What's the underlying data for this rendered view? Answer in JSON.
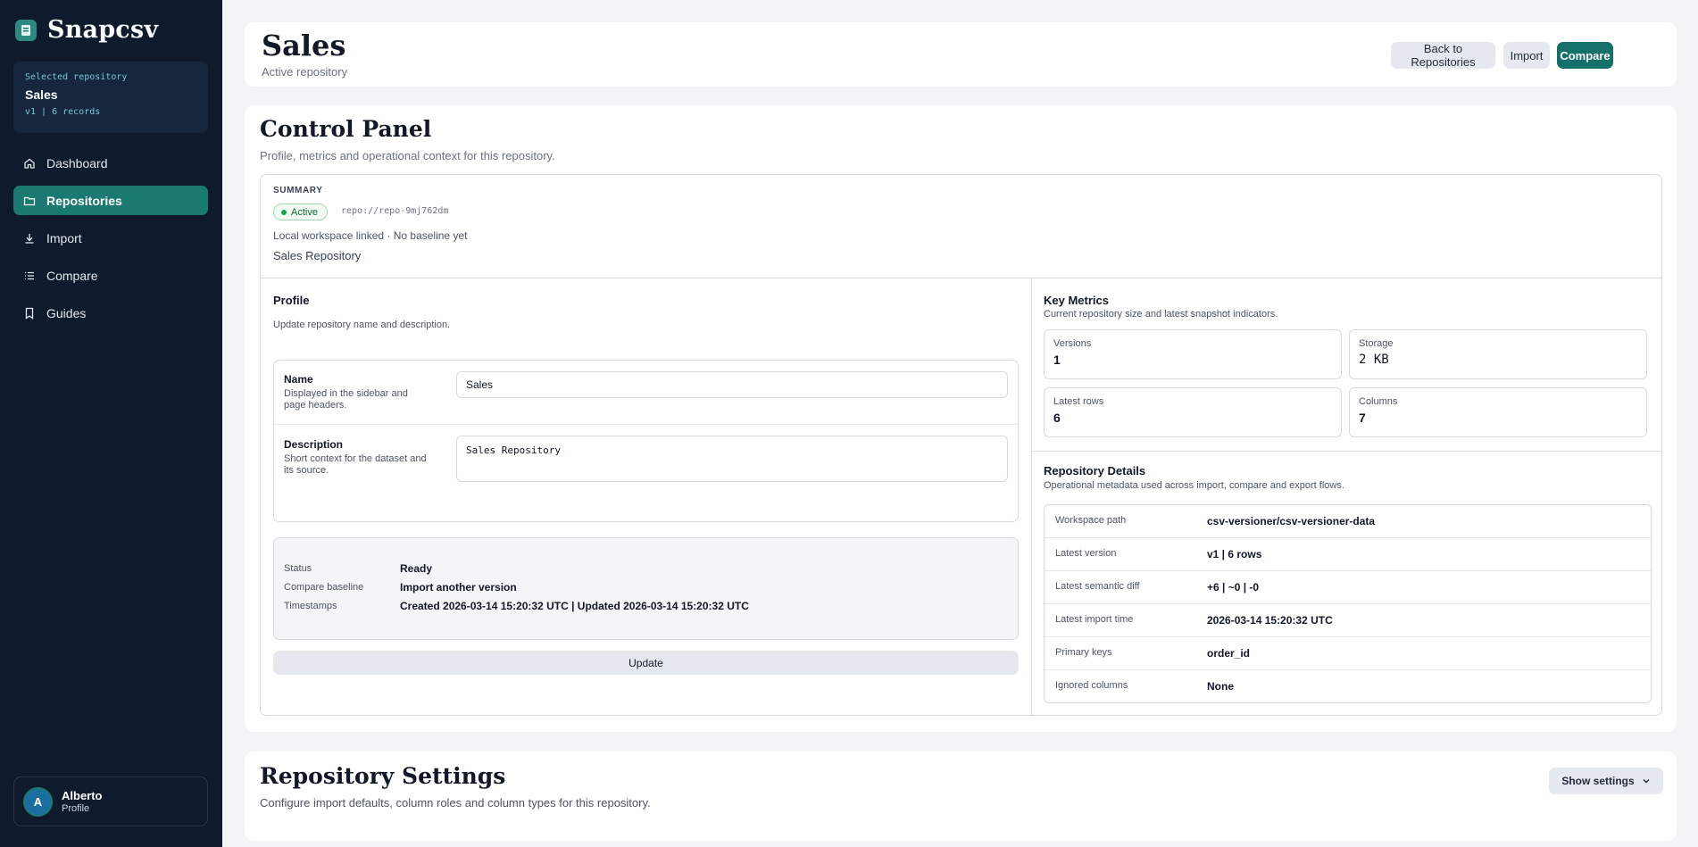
{
  "app": {
    "name": "Snapcsv"
  },
  "sidebar": {
    "selected_label": "Selected repository",
    "selected_name": "Sales",
    "selected_meta": "v1 | 6 records",
    "items": [
      {
        "label": "Dashboard",
        "icon": "home-icon",
        "active": false
      },
      {
        "label": "Repositories",
        "icon": "folder-icon",
        "active": true
      },
      {
        "label": "Import",
        "icon": "download-icon",
        "active": false
      },
      {
        "label": "Compare",
        "icon": "list-icon",
        "active": false
      },
      {
        "label": "Guides",
        "icon": "book-icon",
        "active": false
      }
    ],
    "user": {
      "initial": "A",
      "name": "Alberto",
      "role": "Profile"
    }
  },
  "header": {
    "title": "Sales",
    "subtitle": "Active repository",
    "back_label": "Back to Repositories",
    "import_label": "Import",
    "compare_label": "Compare"
  },
  "control_panel": {
    "title": "Control Panel",
    "subtitle": "Profile, metrics and operational context for this repository.",
    "summary": {
      "label": "SUMMARY",
      "status": "Active",
      "repo_id": "repo://repo-9mj762dm",
      "workspace": "Local workspace linked · No baseline yet",
      "description": "Sales Repository"
    },
    "profile": {
      "title": "Profile",
      "subtitle": "Update repository name and description.",
      "name_label": "Name",
      "name_help": "Displayed in the sidebar and page headers.",
      "name_value": "Sales",
      "desc_label": "Description",
      "desc_help": "Short context for the dataset and its source.",
      "desc_value": "Sales Repository",
      "status_key": "Status",
      "status_value": "Ready",
      "baseline_key": "Compare baseline",
      "baseline_value": "Import another version",
      "timestamps_key": "Timestamps",
      "timestamps_value": "Created 2026-03-14 15:20:32 UTC | Updated 2026-03-14 15:20:32 UTC",
      "update_label": "Update"
    },
    "metrics": {
      "title": "Key Metrics",
      "subtitle": "Current repository size and latest snapshot indicators.",
      "versions_label": "Versions",
      "versions_value": "1",
      "storage_label": "Storage",
      "storage_value": "2 KB",
      "rows_label": "Latest rows",
      "rows_value": "6",
      "columns_label": "Columns",
      "columns_value": "7"
    },
    "details": {
      "title": "Repository Details",
      "subtitle": "Operational metadata used across import, compare and export flows.",
      "rows": [
        {
          "key": "Workspace path",
          "value": "csv-versioner/csv-versioner-data"
        },
        {
          "key": "Latest version",
          "value": "v1 | 6 rows"
        },
        {
          "key": "Latest semantic diff",
          "value": "+6 | ~0 | -0"
        },
        {
          "key": "Latest import time",
          "value": "2026-03-14 15:20:32 UTC"
        },
        {
          "key": "Primary keys",
          "value": "order_id"
        },
        {
          "key": "Ignored columns",
          "value": "None"
        }
      ]
    }
  },
  "settings": {
    "title": "Repository Settings",
    "subtitle": "Configure import defaults, column roles and column types for this repository.",
    "toggle_label": "Show settings"
  },
  "colors": {
    "sidebar_bg": "#0f1b2d",
    "accent": "#14706a",
    "status_green": "#16a34a"
  }
}
